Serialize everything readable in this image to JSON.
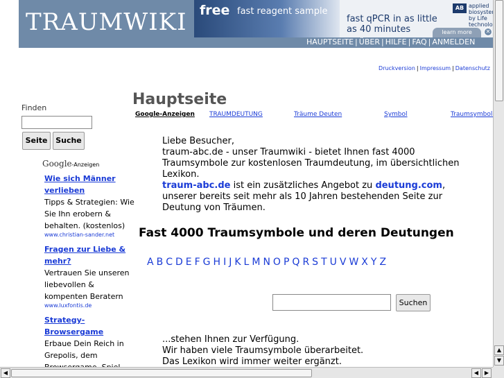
{
  "header": {
    "logo": "TRAUMWIKI",
    "nav": [
      "HAUPTSEITE",
      "ÜBER",
      "HILFE",
      "FAQ",
      "ANMELDEN"
    ]
  },
  "ad_banner": {
    "free": "free",
    "offer": "fast reagent sample",
    "headline_1": "fast qPCR in as little",
    "headline_2": "as 40 minutes",
    "brand_mark": "AB",
    "brand_1": "applied",
    "brand_2": "biosystems",
    "brand_3": "by Life technologies",
    "learn_more": "learn more"
  },
  "utility_links": [
    "Druckversion",
    "Impressum",
    "Datenschutz"
  ],
  "sidebar": {
    "finden_label": "Finden",
    "seite_button": "Seite",
    "suche_button": "Suche",
    "ads_header_logo": "Google",
    "ads_header_label": "-Anzeigen",
    "ads": [
      {
        "title": "Wie sich Männer verlieben",
        "desc": "Tipps & Strategien: Wie Sie Ihn erobern & behalten. (kostenlos)",
        "url": "www.christian-sander.net"
      },
      {
        "title": "Fragen zur Liebe & mehr?",
        "desc": "Vertrauen Sie unseren liebevollen & kompenten Beratern",
        "url": "www.luxfontis.de"
      },
      {
        "title": "Strategy-Browsergame",
        "desc": "Erbaue Dein Reich in Grepolis, dem Browsergame. Spiel jetzt",
        "url": ""
      }
    ]
  },
  "main": {
    "title": "Hauptseite",
    "linkbar_label": "Google-Anzeigen",
    "linkbar_links": [
      "TRAUMDEUTUNG",
      "Träume Deuten",
      "Symbol",
      "Traumsymbole"
    ],
    "intro_greeting": "Liebe Besucher,",
    "intro_line": "traum-abc.de - unser Traumwiki - bietet Ihnen fast 4000 Traumsymbole zur kostenlosen Traumdeutung, im übersichtlichen Lexikon.",
    "intro_brand": "traum-abc.de",
    "intro_mid": " ist ein zusätzliches Angebot zu ",
    "intro_brand2": "deutung.com",
    "intro_end": ", unserer bereits seit mehr als 10 Jahren bestehenden Seite zur Deutung von Träumen.",
    "section_heading": "Fast 4000 Traumsymbole und deren Deutungen",
    "alphabet": [
      "A",
      "B",
      "C",
      "D",
      "E",
      "F",
      "G",
      "H",
      "I",
      "J",
      "K",
      "L",
      "M",
      "N",
      "O",
      "P",
      "Q",
      "R",
      "S",
      "T",
      "U",
      "V",
      "W",
      "X",
      "Y",
      "Z"
    ],
    "search_button": "Suchen",
    "outro_1": "...stehen Ihnen zur Verfügung.",
    "outro_2": "Wir haben viele Traumsymbole überarbeitet.",
    "outro_3": "Das Lexikon wird immer weiter ergänzt."
  }
}
